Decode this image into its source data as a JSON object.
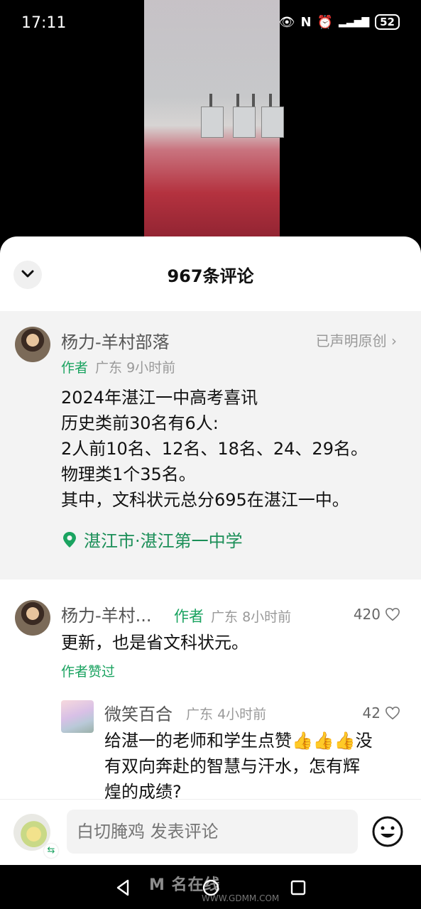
{
  "status_bar": {
    "time": "17:11",
    "battery": "52"
  },
  "sheet": {
    "title": "967条评论"
  },
  "pinned_comment": {
    "username": "杨力-羊村部落",
    "claim": "已声明原创",
    "author_tag": "作者",
    "region": "广东",
    "time": "9小时前",
    "body": "2024年湛江一中高考喜讯\n历史类前30名有6人:\n2人前10名、12名、18名、24、29名。\n物理类1个35名。\n其中，文科状元总分695在湛江一中。",
    "location": "湛江市·湛江第一中学"
  },
  "comment_1": {
    "username": "杨力-羊村...",
    "author_tag": "作者",
    "region": "广东",
    "time": "8小时前",
    "likes": "420",
    "body": "更新，也是省文科状元。",
    "liked_tag": "作者赞过"
  },
  "reply_1": {
    "username": "微笑百合",
    "region": "广东",
    "time": "4小时前",
    "likes": "42",
    "body": "给湛一的老师和学生点赞👍👍👍没\n有双向奔赴的智慧与汗水，怎有辉\n煌的成绩?"
  },
  "composer": {
    "placeholder": "白切腌鸡 发表评论"
  },
  "watermark": {
    "text": "M 名在线",
    "sub": "WWW.GDMM.COM"
  }
}
